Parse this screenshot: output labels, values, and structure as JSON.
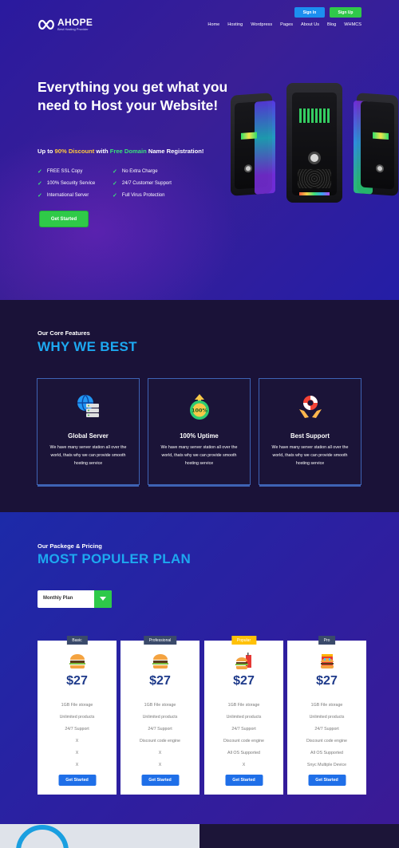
{
  "brand": {
    "name": "AHOPE",
    "tagline": "Best Hosting Provider"
  },
  "header": {
    "signin": "Sign In",
    "signup": "Sign Up",
    "nav": [
      "Home",
      "Hosting",
      "Wordpress",
      "Pages",
      "About Us",
      "Blog",
      "WHMCS"
    ]
  },
  "hero": {
    "title": "Everything you get what you need to Host your Website!",
    "sub_a": "Up to ",
    "sub_b": "90% Discount",
    "sub_c": " with ",
    "sub_d": "Free Domain",
    "sub_e": " Name Registration!",
    "features": [
      "FREE SSL Copy",
      "No Extra Charge",
      "100% Security Service",
      "24/7 Customer Support",
      "International Server",
      "Full Virus Protection"
    ],
    "cta": "Get Started",
    "illustration": "server-towers-image"
  },
  "why": {
    "eyebrow": "Our Core Features",
    "title": "WHY WE BEST",
    "cards": [
      {
        "icon": "globe-server-icon",
        "title": "Global Server",
        "desc": "We have many server station all over the world, thats why we can provide smooth hosting service"
      },
      {
        "icon": "uptime-badge-icon",
        "title": "100% Uptime",
        "desc": "We have many server station all over the world, thats why we can provide smooth hosting service"
      },
      {
        "icon": "lifebuoy-icon",
        "title": "Best Support",
        "desc": "We have many server station all over the world, thats why we can provide smooth hosting service"
      }
    ]
  },
  "pricing": {
    "eyebrow": "Our Packege & Pricing",
    "title": "MOST POPULER PLAN",
    "select": "Monthly Plan",
    "plans": [
      {
        "badge": "Basic",
        "icon": "burger-icon",
        "price": "$27",
        "features": [
          "1GB File storage",
          "Unlimited products",
          "24/7 Support",
          "X",
          "X",
          "X"
        ],
        "cta": "Get Started"
      },
      {
        "badge": "Professional",
        "icon": "burger-icon",
        "price": "$27",
        "features": [
          "1GB File storage",
          "Unlimited products",
          "24/7 Support",
          "Discount code engine",
          "X",
          "X"
        ],
        "cta": "Get Started"
      },
      {
        "badge": "Popular",
        "icon": "burger-drink-icon",
        "price": "$27",
        "features": [
          "1GB File storage",
          "Unlimited products",
          "24/7 Support",
          "Discount code engine",
          "All OS Supported",
          "X"
        ],
        "cta": "Get Started"
      },
      {
        "badge": "Pro",
        "icon": "meal-icon",
        "price": "$27",
        "features": [
          "1GB File storage",
          "Unlimited products",
          "24/7 Support",
          "Discount code engine",
          "All OS Supported",
          "Snyc Multiple Device"
        ],
        "cta": "Get Started"
      }
    ]
  },
  "colors": {
    "accent_blue": "#1da8f0",
    "accent_green": "#30c84a",
    "highlight_yellow": "#ffc93c",
    "price_navy": "#1e3a8a"
  }
}
